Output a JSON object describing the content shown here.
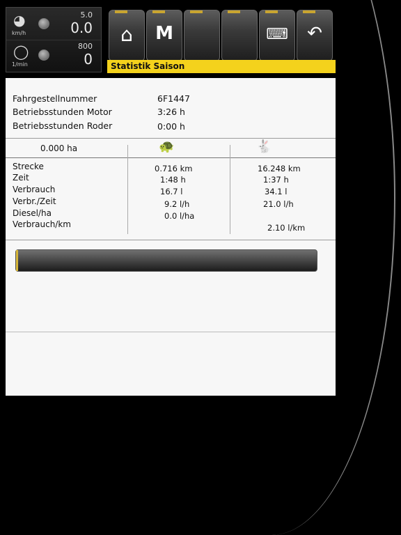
{
  "gauges": {
    "speed": {
      "unit": "km/h",
      "setpoint": "5.0",
      "value": "0.0"
    },
    "rpm": {
      "unit": "1/min",
      "setpoint": "800",
      "value": "0"
    }
  },
  "toolbar": {
    "buttons": [
      {
        "icon": "home-icon"
      },
      {
        "icon": "machine-icon"
      },
      {
        "icon": ""
      },
      {
        "icon": ""
      },
      {
        "icon": "keyboard-icon"
      },
      {
        "icon": "back-icon"
      }
    ],
    "title": "Statistik Saison"
  },
  "info": {
    "rows": [
      {
        "label": "Fahrgestellnummer",
        "value": "6F1447"
      },
      {
        "label": "Betriebsstunden Motor",
        "value": "3:26 h"
      },
      {
        "label": "Betriebsstunden Roder",
        "value": "0:00 h"
      }
    ]
  },
  "stats": {
    "area": "0.000 ha",
    "col1_icon": "turtle-icon",
    "col2_icon": "hare-icon",
    "rows": [
      {
        "label": "Strecke",
        "slow": "0.716 km",
        "fast": "16.248 km"
      },
      {
        "label": "Zeit",
        "slow": "1:48 h",
        "fast": "1:37 h"
      },
      {
        "label": "Verbrauch",
        "slow": "16.7 l",
        "fast": "34.1 l"
      },
      {
        "label": "Verbr./Zeit",
        "slow": "9.2 l/h",
        "fast": "21.0 l/h"
      },
      {
        "label": "Diesel/ha",
        "slow": "0.0 l/ha",
        "fast": ""
      },
      {
        "label": "Verbrauch/km",
        "slow": "",
        "fast": "2.10 l/km"
      }
    ]
  },
  "progress": {
    "percent": 0.5,
    "color": "#d6b63a"
  }
}
